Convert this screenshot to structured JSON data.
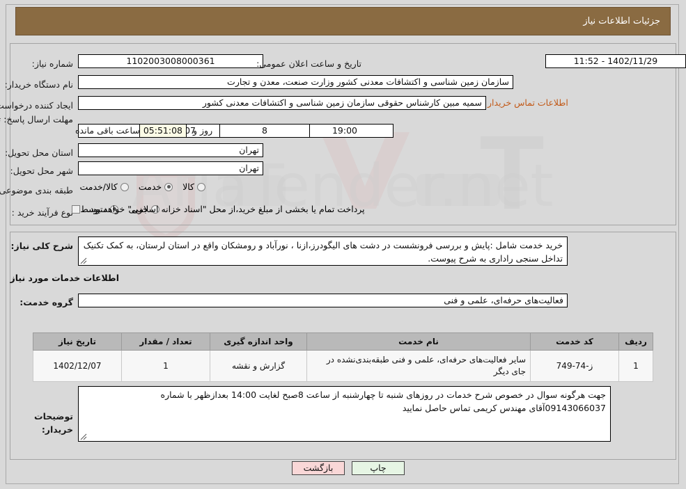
{
  "header": {
    "title": "جزئیات اطلاعات نیاز"
  },
  "top_form": {
    "need_number_label": "شماره نیاز:",
    "need_number_value": "1102003008000361",
    "announce_label": "تاریخ و ساعت اعلان عمومی:",
    "announce_value": "1402/11/29 - 11:52",
    "buyer_org_label": "نام دستگاه خریدار:",
    "buyer_org_value": "سازمان زمین شناسی و اکتشافات معدنی کشور وزارت صنعت، معدن و تجارت",
    "creator_label": "ایجاد کننده درخواست:",
    "creator_value": "سمیه مبین کارشناس حقوقی سازمان زمین شناسی و اکتشافات معدنی کشور",
    "contact_link": "اطلاعات تماس خریدار",
    "deadline_label": "مهلت ارسال پاسخ: تا تاریخ:",
    "deadline_date": "1402/12/07",
    "hour_label": "ساعت",
    "deadline_time": "19:00",
    "days_value": "8",
    "days_and_label": "روز و",
    "countdown_value": "05:51:08",
    "remaining_label": "ساعت باقی مانده",
    "province_label": "استان محل تحویل:",
    "province_value": "تهران",
    "city_label": "شهر محل تحویل:",
    "city_value": "تهران",
    "category_label": "طبقه بندی موضوعی:",
    "category_options": [
      {
        "label": "کالا",
        "selected": false
      },
      {
        "label": "خدمت",
        "selected": true
      },
      {
        "label": "کالا/خدمت",
        "selected": false
      }
    ],
    "process_label": "نوع فرآیند خرید :",
    "process_options": [
      {
        "label": "جزیی",
        "selected": false
      },
      {
        "label": "متوسط",
        "selected": true
      }
    ],
    "treasury_note": "پرداخت تمام یا بخشی از مبلغ خرید،از محل \"اسناد خزانه اسلامی\" خواهد بود."
  },
  "description": {
    "label": "شرح کلی نیاز:",
    "value": "خرید خدمت شامل :پایش و بررسی فرونشست در دشت های الیگودرز،ازنا ، نورآباد و رومشکان واقع در استان لرستان، به کمک تکنیک تداخل سنجی راداری به شرح پیوست."
  },
  "services": {
    "section_title": "اطلاعات خدمات مورد نیاز",
    "group_label": "گروه خدمت:",
    "group_value": "فعالیت‌های حرفه‌ای، علمی و فنی",
    "columns": [
      "ردیف",
      "کد خدمت",
      "نام خدمت",
      "واحد اندازه گیری",
      "تعداد / مقدار",
      "تاریخ نیاز"
    ],
    "rows": [
      {
        "index": "1",
        "code": "ز-74-749",
        "name": "سایر فعالیت‌های حرفه‌ای، علمی و فنی طبقه‌بندی‌نشده در جای دیگر",
        "unit": "گزارش و نقشه",
        "qty": "1",
        "date": "1402/12/07"
      }
    ]
  },
  "notes": {
    "label": "توضیحات خریدار:",
    "value": "جهت هرگونه سوال در خصوص شرح خدمات در روزهای شنبه تا چهارشنبه از ساعت  8صبح لغایت 14:00 بعدازظهر با شماره  09143066037آقای مهندس کریمی تماس حاصل نمایید"
  },
  "buttons": {
    "print": "چاپ",
    "back": "بازگشت"
  },
  "colors": {
    "header_bg": "#8a6b42",
    "link": "#c25a19",
    "print_btn": "#e6f5e4",
    "back_btn": "#f9d7d7",
    "countdown_bg": "#fbfbe6",
    "table_header_bg": "#b9b9b9",
    "page_bg": "#d9d9d9"
  },
  "watermark": {
    "text": "AriaTender.net"
  }
}
